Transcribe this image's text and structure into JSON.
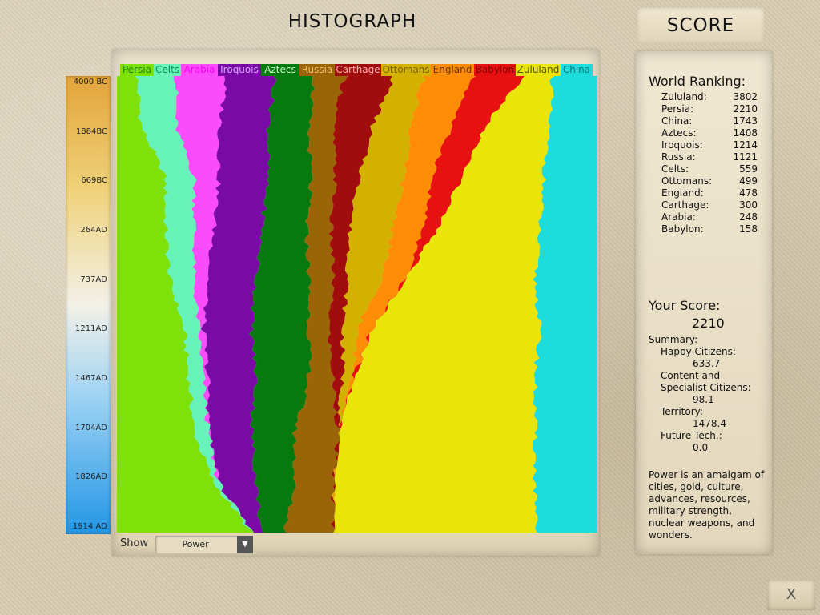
{
  "title": "HISTOGRAPH",
  "score_tab": "SCORE",
  "civs": [
    {
      "name": "Persia",
      "color": "#7fe10a",
      "label_color": "#1a8a1a"
    },
    {
      "name": "Celts",
      "color": "#66f2b8",
      "label_color": "#0b8f5c"
    },
    {
      "name": "Arabia",
      "color": "#fa4cfa",
      "label_color": "#f0f"
    },
    {
      "name": "Iroquois",
      "color": "#7a0aa6",
      "label_color": "#d7a7ff"
    },
    {
      "name": "Aztecs",
      "color": "#077a0f",
      "label_color": "#c9f7c9"
    },
    {
      "name": "Russia",
      "color": "#9a6507",
      "label_color": "#f0c070"
    },
    {
      "name": "Carthage",
      "color": "#a10d0d",
      "label_color": "#ffb0b0"
    },
    {
      "name": "Ottomans",
      "color": "#d2b100",
      "label_color": "#7a6200"
    },
    {
      "name": "England",
      "color": "#ff8c05",
      "label_color": "#6a3300"
    },
    {
      "name": "Babylon",
      "color": "#e71111",
      "label_color": "#7a0000"
    },
    {
      "name": "Zululand",
      "color": "#e9e50a",
      "label_color": "#555500"
    },
    {
      "name": "China",
      "color": "#1cdcdc",
      "label_color": "#057a7a"
    }
  ],
  "time_ticks": [
    "4000 BC",
    "1884BC",
    "669BC",
    "264AD",
    "737AD",
    "1211AD",
    "1467AD",
    "1704AD",
    "1826AD",
    "1914 AD"
  ],
  "show": {
    "label": "Show",
    "value": "Power"
  },
  "chart_data": {
    "type": "area",
    "subtype": "stacked-100-percent",
    "x": [
      "4000 BC",
      "1884BC",
      "669BC",
      "264AD",
      "737AD",
      "1211AD",
      "1467AD",
      "1704AD",
      "1826AD",
      "1914 AD"
    ],
    "series": [
      {
        "name": "Persia",
        "values": [
          4,
          5,
          10,
          10,
          11,
          14,
          15,
          16,
          20,
          28
        ]
      },
      {
        "name": "Celts",
        "values": [
          8,
          7,
          6,
          6,
          5,
          3,
          3,
          3,
          1,
          0
        ]
      },
      {
        "name": "Arabia",
        "values": [
          10,
          9,
          5,
          4,
          3,
          1,
          1,
          0,
          0,
          0
        ]
      },
      {
        "name": "Iroquois",
        "values": [
          10,
          10,
          10,
          10,
          10,
          10,
          10,
          9,
          8,
          2
        ]
      },
      {
        "name": "Aztecs",
        "values": [
          8,
          8,
          9,
          9,
          11,
          12,
          11,
          9,
          8,
          5
        ]
      },
      {
        "name": "Russia",
        "values": [
          6,
          5,
          5,
          5,
          5,
          4,
          5,
          9,
          8,
          10
        ]
      },
      {
        "name": "Carthage",
        "values": [
          10,
          8,
          5,
          4,
          3,
          3,
          2,
          0,
          0,
          0
        ]
      },
      {
        "name": "Ottomans",
        "values": [
          6,
          8,
          9,
          9,
          7,
          3,
          2,
          0,
          0,
          0
        ]
      },
      {
        "name": "England",
        "values": [
          10,
          8,
          6,
          6,
          5,
          3,
          0,
          0,
          0,
          0
        ]
      },
      {
        "name": "Babylon",
        "values": [
          10,
          7,
          6,
          3,
          0,
          0,
          0,
          0,
          0,
          0
        ]
      },
      {
        "name": "Zululand",
        "values": [
          6,
          13,
          17,
          21,
          27,
          35,
          38,
          41,
          42,
          42
        ]
      },
      {
        "name": "China",
        "values": [
          9,
          10,
          11,
          12,
          13,
          12,
          13,
          13,
          13,
          13
        ]
      }
    ]
  },
  "score_panel": {
    "ranking_heading": "World Ranking:",
    "ranking": [
      {
        "name": "Zululand:",
        "score": "3802"
      },
      {
        "name": "Persia:",
        "score": "2210"
      },
      {
        "name": "China:",
        "score": "1743"
      },
      {
        "name": "Aztecs:",
        "score": "1408"
      },
      {
        "name": "Iroquois:",
        "score": "1214"
      },
      {
        "name": "Russia:",
        "score": "1121"
      },
      {
        "name": "Celts:",
        "score": "559"
      },
      {
        "name": "Ottomans:",
        "score": "499"
      },
      {
        "name": "England:",
        "score": "478"
      },
      {
        "name": "Carthage:",
        "score": "300"
      },
      {
        "name": "Arabia:",
        "score": "248"
      },
      {
        "name": "Babylon:",
        "score": "158"
      }
    ],
    "your_score_heading": "Your Score:",
    "your_score": "2210",
    "summary_label": "Summary:",
    "happy_label": "Happy Citizens:",
    "happy_value": "633.7",
    "content_label_1": "Content and",
    "content_label_2": "Specialist Citizens:",
    "content_value": "98.1",
    "territory_label": "Territory:",
    "territory_value": "1478.4",
    "future_label": "Future Tech.:",
    "future_value": "0.0",
    "power_note": "Power is an amalgam of cities, gold, culture, advances, resources, military strength, nuclear weapons, and wonders."
  },
  "close_button": "X"
}
